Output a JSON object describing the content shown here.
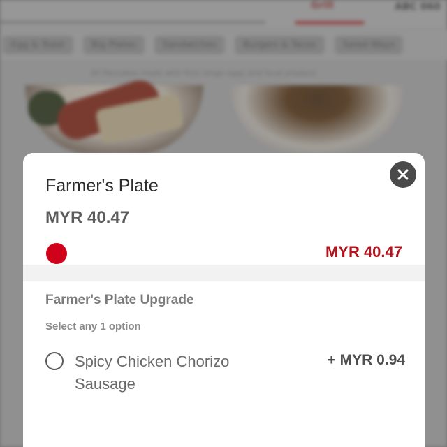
{
  "background": {
    "active_tab": "Grill",
    "right_label": "ABC 060",
    "categories": [
      "Egg & Toast",
      "Big Plates",
      "Sandwiches",
      "Burgers & Tacos",
      "Salad Ways"
    ],
    "note": "All Pancakes made with free-range eggs and local produce"
  },
  "modal": {
    "title": "Farmer's Plate",
    "price": "MYR 40.47",
    "total_price": "MYR 40.47",
    "accent_color": "#d0021b",
    "close_icon": "close-icon",
    "section": {
      "title": "Farmer's Plate Upgrade",
      "hint": "Select any 1 option",
      "options": [
        {
          "label": "Spicy Chicken Chorizo Sausage",
          "price": "+ MYR 0.94",
          "selected": false
        }
      ]
    }
  }
}
